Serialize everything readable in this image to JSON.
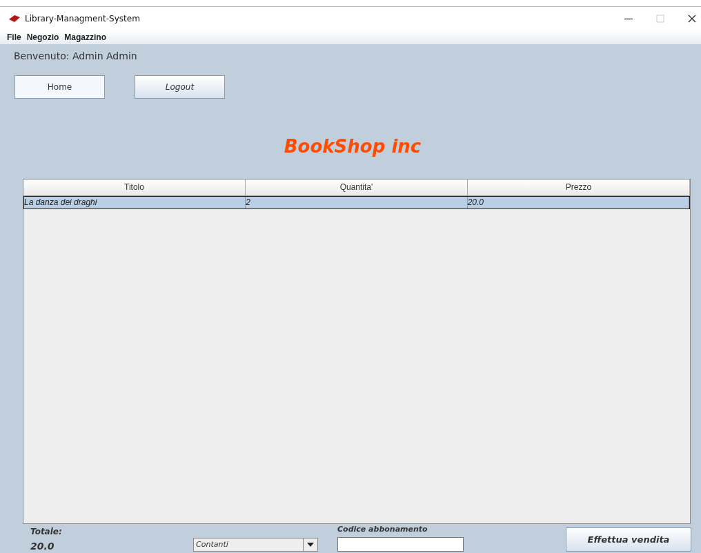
{
  "window": {
    "title": "Library-Managment-System"
  },
  "menu": [
    "File",
    "Negozio",
    "Magazzino"
  ],
  "welcome": "Benvenuto: Admin Admin",
  "nav_buttons": [
    {
      "label": "Home",
      "italic": false
    },
    {
      "label": "Logout",
      "italic": true
    }
  ],
  "heading": "BookShop inc",
  "table": {
    "columns": [
      "Titolo",
      "Quantita'",
      "Prezzo"
    ],
    "rows": [
      {
        "cells": [
          "La danza dei draghi",
          "2",
          "20.0"
        ],
        "selected": true
      }
    ]
  },
  "footer": {
    "total_label": "Totale:",
    "total_value": "20.0",
    "payment": {
      "value": "Contanti"
    },
    "code_label": "Codice abbonamento",
    "sale_button": "Effettua vendita"
  }
}
